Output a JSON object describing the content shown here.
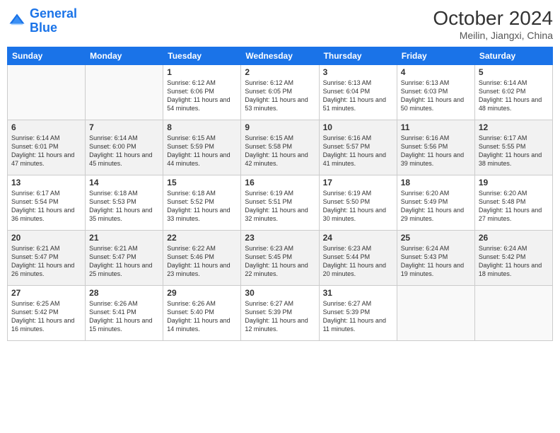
{
  "logo": {
    "text_general": "General",
    "text_blue": "Blue"
  },
  "title": "October 2024",
  "subtitle": "Meilin, Jiangxi, China",
  "weekdays": [
    "Sunday",
    "Monday",
    "Tuesday",
    "Wednesday",
    "Thursday",
    "Friday",
    "Saturday"
  ],
  "weeks": [
    [
      {
        "num": "",
        "sunrise": "",
        "sunset": "",
        "daylight": ""
      },
      {
        "num": "",
        "sunrise": "",
        "sunset": "",
        "daylight": ""
      },
      {
        "num": "1",
        "sunrise": "Sunrise: 6:12 AM",
        "sunset": "Sunset: 6:06 PM",
        "daylight": "Daylight: 11 hours and 54 minutes."
      },
      {
        "num": "2",
        "sunrise": "Sunrise: 6:12 AM",
        "sunset": "Sunset: 6:05 PM",
        "daylight": "Daylight: 11 hours and 53 minutes."
      },
      {
        "num": "3",
        "sunrise": "Sunrise: 6:13 AM",
        "sunset": "Sunset: 6:04 PM",
        "daylight": "Daylight: 11 hours and 51 minutes."
      },
      {
        "num": "4",
        "sunrise": "Sunrise: 6:13 AM",
        "sunset": "Sunset: 6:03 PM",
        "daylight": "Daylight: 11 hours and 50 minutes."
      },
      {
        "num": "5",
        "sunrise": "Sunrise: 6:14 AM",
        "sunset": "Sunset: 6:02 PM",
        "daylight": "Daylight: 11 hours and 48 minutes."
      }
    ],
    [
      {
        "num": "6",
        "sunrise": "Sunrise: 6:14 AM",
        "sunset": "Sunset: 6:01 PM",
        "daylight": "Daylight: 11 hours and 47 minutes."
      },
      {
        "num": "7",
        "sunrise": "Sunrise: 6:14 AM",
        "sunset": "Sunset: 6:00 PM",
        "daylight": "Daylight: 11 hours and 45 minutes."
      },
      {
        "num": "8",
        "sunrise": "Sunrise: 6:15 AM",
        "sunset": "Sunset: 5:59 PM",
        "daylight": "Daylight: 11 hours and 44 minutes."
      },
      {
        "num": "9",
        "sunrise": "Sunrise: 6:15 AM",
        "sunset": "Sunset: 5:58 PM",
        "daylight": "Daylight: 11 hours and 42 minutes."
      },
      {
        "num": "10",
        "sunrise": "Sunrise: 6:16 AM",
        "sunset": "Sunset: 5:57 PM",
        "daylight": "Daylight: 11 hours and 41 minutes."
      },
      {
        "num": "11",
        "sunrise": "Sunrise: 6:16 AM",
        "sunset": "Sunset: 5:56 PM",
        "daylight": "Daylight: 11 hours and 39 minutes."
      },
      {
        "num": "12",
        "sunrise": "Sunrise: 6:17 AM",
        "sunset": "Sunset: 5:55 PM",
        "daylight": "Daylight: 11 hours and 38 minutes."
      }
    ],
    [
      {
        "num": "13",
        "sunrise": "Sunrise: 6:17 AM",
        "sunset": "Sunset: 5:54 PM",
        "daylight": "Daylight: 11 hours and 36 minutes."
      },
      {
        "num": "14",
        "sunrise": "Sunrise: 6:18 AM",
        "sunset": "Sunset: 5:53 PM",
        "daylight": "Daylight: 11 hours and 35 minutes."
      },
      {
        "num": "15",
        "sunrise": "Sunrise: 6:18 AM",
        "sunset": "Sunset: 5:52 PM",
        "daylight": "Daylight: 11 hours and 33 minutes."
      },
      {
        "num": "16",
        "sunrise": "Sunrise: 6:19 AM",
        "sunset": "Sunset: 5:51 PM",
        "daylight": "Daylight: 11 hours and 32 minutes."
      },
      {
        "num": "17",
        "sunrise": "Sunrise: 6:19 AM",
        "sunset": "Sunset: 5:50 PM",
        "daylight": "Daylight: 11 hours and 30 minutes."
      },
      {
        "num": "18",
        "sunrise": "Sunrise: 6:20 AM",
        "sunset": "Sunset: 5:49 PM",
        "daylight": "Daylight: 11 hours and 29 minutes."
      },
      {
        "num": "19",
        "sunrise": "Sunrise: 6:20 AM",
        "sunset": "Sunset: 5:48 PM",
        "daylight": "Daylight: 11 hours and 27 minutes."
      }
    ],
    [
      {
        "num": "20",
        "sunrise": "Sunrise: 6:21 AM",
        "sunset": "Sunset: 5:47 PM",
        "daylight": "Daylight: 11 hours and 26 minutes."
      },
      {
        "num": "21",
        "sunrise": "Sunrise: 6:21 AM",
        "sunset": "Sunset: 5:47 PM",
        "daylight": "Daylight: 11 hours and 25 minutes."
      },
      {
        "num": "22",
        "sunrise": "Sunrise: 6:22 AM",
        "sunset": "Sunset: 5:46 PM",
        "daylight": "Daylight: 11 hours and 23 minutes."
      },
      {
        "num": "23",
        "sunrise": "Sunrise: 6:23 AM",
        "sunset": "Sunset: 5:45 PM",
        "daylight": "Daylight: 11 hours and 22 minutes."
      },
      {
        "num": "24",
        "sunrise": "Sunrise: 6:23 AM",
        "sunset": "Sunset: 5:44 PM",
        "daylight": "Daylight: 11 hours and 20 minutes."
      },
      {
        "num": "25",
        "sunrise": "Sunrise: 6:24 AM",
        "sunset": "Sunset: 5:43 PM",
        "daylight": "Daylight: 11 hours and 19 minutes."
      },
      {
        "num": "26",
        "sunrise": "Sunrise: 6:24 AM",
        "sunset": "Sunset: 5:42 PM",
        "daylight": "Daylight: 11 hours and 18 minutes."
      }
    ],
    [
      {
        "num": "27",
        "sunrise": "Sunrise: 6:25 AM",
        "sunset": "Sunset: 5:42 PM",
        "daylight": "Daylight: 11 hours and 16 minutes."
      },
      {
        "num": "28",
        "sunrise": "Sunrise: 6:26 AM",
        "sunset": "Sunset: 5:41 PM",
        "daylight": "Daylight: 11 hours and 15 minutes."
      },
      {
        "num": "29",
        "sunrise": "Sunrise: 6:26 AM",
        "sunset": "Sunset: 5:40 PM",
        "daylight": "Daylight: 11 hours and 14 minutes."
      },
      {
        "num": "30",
        "sunrise": "Sunrise: 6:27 AM",
        "sunset": "Sunset: 5:39 PM",
        "daylight": "Daylight: 11 hours and 12 minutes."
      },
      {
        "num": "31",
        "sunrise": "Sunrise: 6:27 AM",
        "sunset": "Sunset: 5:39 PM",
        "daylight": "Daylight: 11 hours and 11 minutes."
      },
      {
        "num": "",
        "sunrise": "",
        "sunset": "",
        "daylight": ""
      },
      {
        "num": "",
        "sunrise": "",
        "sunset": "",
        "daylight": ""
      }
    ]
  ]
}
